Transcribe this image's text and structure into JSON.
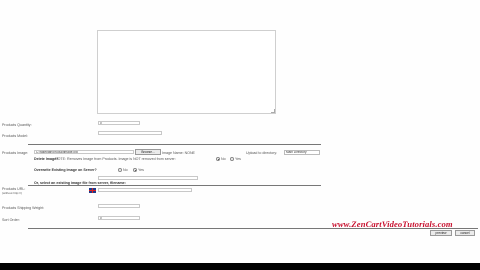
{
  "form": {
    "quantity_label": "Products Quantity:",
    "quantity_value": "0",
    "model_label": "Products Model:",
    "model_value": "",
    "image_label": "Products Image:",
    "image_file": "C:\\fakepath\\productimage.jpg",
    "browse_label": "Browse...",
    "image_name_label": "Image Name: NONE",
    "upload_dir_label": "Upload to directory:",
    "upload_dir_value": "Main Directory",
    "delete_label": "Delete Image?",
    "delete_note": "NOTE: Removes Image from Products. Image is NOT removed from server:",
    "delete_no": "No",
    "delete_yes": "Yes",
    "overwrite_label": "Overwrite Existing Image on Server?",
    "overwrite_no": "No",
    "overwrite_yes": "Yes",
    "existing_label": "Or, select an existing image file from server, filename:",
    "url_label": "Products URL:",
    "url_note": "(without http://)",
    "weight_label": "Products Shipping Weight:",
    "weight_value": "",
    "sort_label": "Sort Order:",
    "sort_value": "0",
    "preview_label": "preview",
    "cancel_label": "cancel"
  },
  "overlay": {
    "watermark": "www.ZenCartVideoTutorials.com"
  }
}
